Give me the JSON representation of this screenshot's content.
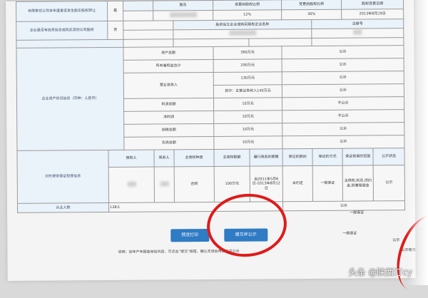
{
  "sections": {
    "equity_change_label": "有限责任公司本年度是否发生股东股权转让",
    "equity_change_value": "是",
    "invest_label": "企业是否有投资信息或购买其他公司股权",
    "invest_value": "否",
    "assets_label": "企业资产状况信息（币种：人民币）",
    "guarantee_label": "对外提供保证担保信息",
    "headcount_label": "从业人数",
    "headcount_value": "128人"
  },
  "equity_header": [
    "股东",
    "变更前股权比例",
    "变更后股权比例",
    "股权变更日期"
  ],
  "equity_row": {
    "before": "12%",
    "after": "30%",
    "date": "2013年8月19日"
  },
  "invest_header": {
    "name": "投资设立企业或购买股权企业名称",
    "reg": "注册号"
  },
  "public_label": "公示",
  "assets": [
    {
      "name": "资产总额",
      "value": "360万元",
      "status": "公示"
    },
    {
      "name": "所有者权益合计",
      "value": "290万元",
      "status": "公示"
    },
    {
      "name": "营业总收入",
      "value": "130万元",
      "status": "公示"
    },
    {
      "name": "",
      "value": "其中：主营业务收入140万元",
      "status": "公示"
    },
    {
      "name": "利润总额",
      "value": "10万元",
      "status": "不公示"
    },
    {
      "name": "净利润",
      "value": "10万元",
      "status": "不公示"
    },
    {
      "name": "纳税总额",
      "value": "10万元",
      "status": "公示"
    },
    {
      "name": "负债总额",
      "value": "10万元",
      "status": "公示"
    }
  ],
  "guarantee_header": [
    "债权人",
    "债务人",
    "主债权种类",
    "主债权数额",
    "履行债务的期限",
    "保证的期间",
    "保证的方式",
    "保证担保的范围",
    "公示状态"
  ],
  "guarantee_row": {
    "type": "合同",
    "amount": "100万元",
    "period": "自2011年5月6日-2013年8月12日",
    "guarantee_period": "未约定",
    "method": "一般保证",
    "scope": "主债权,利息,违约金,损害赔偿金",
    "status": "公示"
  },
  "buttons": {
    "print": "预览打印",
    "submit": "提交并公示"
  },
  "note": "说明：如年产年报查询信内容，可点击“提交”按钮，确认无误后再提交并公示",
  "fragments": {
    "f1": "一般保证",
    "f2": "一般保证",
    "f3": "公示",
    "f4": "公示情况"
  },
  "watermark": "头条 @陕西汀cy",
  "colors": {
    "label_bg": "#eaf2fa",
    "button": "#2f7bc4",
    "circle": "#e01a1a"
  }
}
